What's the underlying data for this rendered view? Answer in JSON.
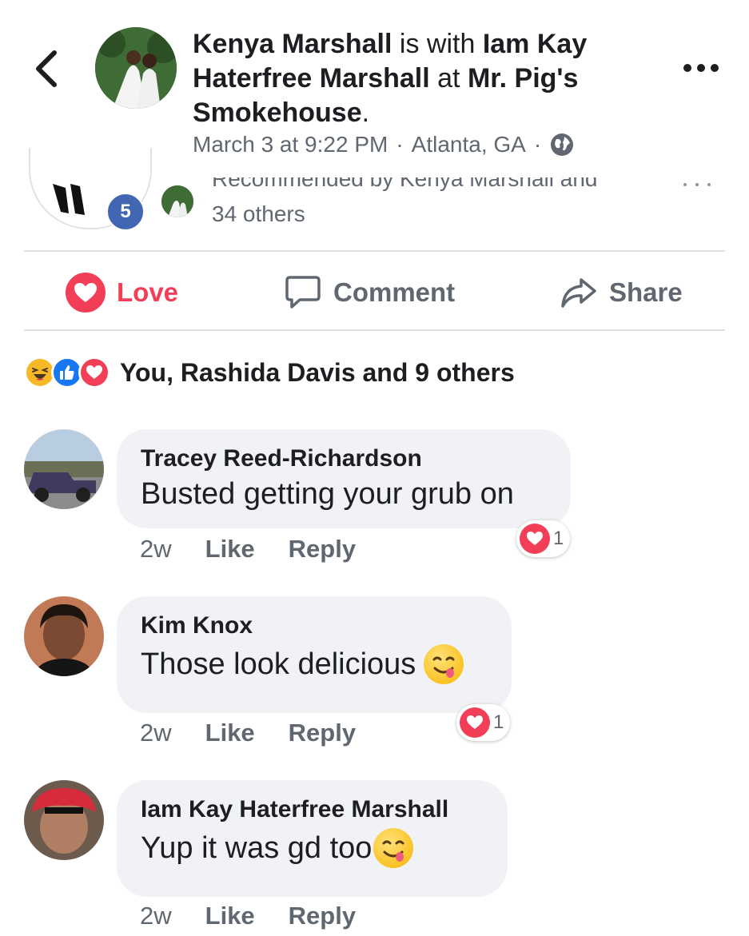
{
  "header": {
    "author": "Kenya Marshall",
    "with_text": "is with",
    "tagged": "Iam Kay Haterfree Marshall",
    "at_text": "at",
    "place": "Mr. Pig's Smokehouse",
    "period": ".",
    "time": "March 3 at 9:22 PM",
    "separator": "·",
    "location": "Atlanta, GA",
    "separator2": "·"
  },
  "recommendation": {
    "text": "Recommended by Kenya Marshall and",
    "others": "34 others",
    "count_badge": "5"
  },
  "actions": {
    "love": "Love",
    "comment": "Comment",
    "share": "Share"
  },
  "reactions_summary": {
    "text": "You, Rashida Davis and 9 others",
    "icons": [
      "haha-icon",
      "like-icon",
      "love-icon"
    ]
  },
  "comments": [
    {
      "name": "Tracey Reed-Richardson",
      "text": "Busted getting your grub on",
      "time": "2w",
      "like": "Like",
      "reply": "Reply",
      "reaction_count": "1"
    },
    {
      "name": "Kim Knox",
      "text": "Those look delicious",
      "time": "2w",
      "like": "Like",
      "reply": "Reply",
      "reaction_count": "1"
    },
    {
      "name": "Iam Kay Haterfree Marshall",
      "text": "Yup it was gd too",
      "time": "2w",
      "like": "Like",
      "reply": "Reply"
    }
  ],
  "colors": {
    "love_red": "#f33e58",
    "facebook_blue": "#4267b2",
    "meta_gray": "#606770",
    "bubble_gray": "#f0f2f5"
  }
}
